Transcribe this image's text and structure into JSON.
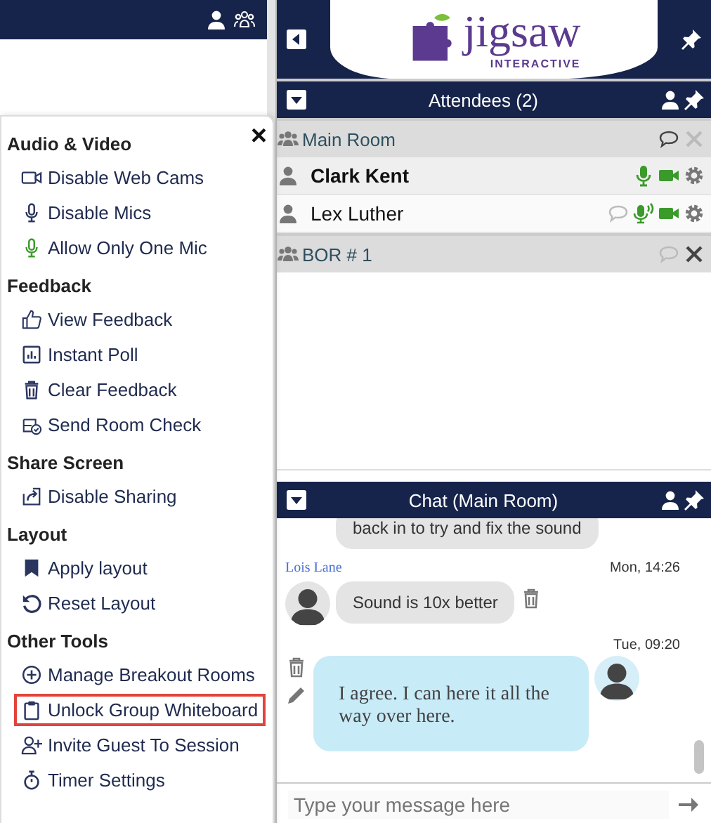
{
  "menu": {
    "close": "×",
    "sections": [
      {
        "title": "Audio & Video",
        "items": [
          {
            "label": "Disable Web Cams",
            "active": false,
            "highlighted": false
          },
          {
            "label": "Disable Mics",
            "active": false,
            "highlighted": false
          },
          {
            "label": "Allow Only One Mic",
            "active": true,
            "highlighted": false
          }
        ]
      },
      {
        "title": "Feedback",
        "items": [
          {
            "label": "View Feedback",
            "active": false,
            "highlighted": false
          },
          {
            "label": "Instant Poll",
            "active": false,
            "highlighted": false
          },
          {
            "label": "Clear Feedback",
            "active": false,
            "highlighted": false
          },
          {
            "label": "Send Room Check",
            "active": false,
            "highlighted": false
          }
        ]
      },
      {
        "title": "Share Screen",
        "items": [
          {
            "label": "Disable Sharing",
            "active": false,
            "highlighted": false
          }
        ]
      },
      {
        "title": "Layout",
        "items": [
          {
            "label": "Apply layout",
            "active": false,
            "highlighted": false
          },
          {
            "label": "Reset Layout",
            "active": false,
            "highlighted": false
          }
        ]
      },
      {
        "title": "Other Tools",
        "items": [
          {
            "label": "Manage Breakout Rooms",
            "active": false,
            "highlighted": false
          },
          {
            "label": "Unlock Group Whiteboard",
            "active": false,
            "highlighted": true
          },
          {
            "label": "Invite Guest To Session",
            "active": false,
            "highlighted": false
          },
          {
            "label": "Timer Settings",
            "active": false,
            "highlighted": false
          }
        ]
      }
    ]
  },
  "logo": {
    "name": "jigsaw",
    "tagline": "INTERACTIVE"
  },
  "attendees": {
    "title": "Attendees (2)",
    "rooms": [
      {
        "name": "Main Room",
        "closable": false,
        "people": [
          {
            "name": "Clark Kent",
            "selected": true,
            "chatting": false,
            "speaking": false
          },
          {
            "name": "Lex Luther",
            "selected": false,
            "chatting": true,
            "speaking": true
          }
        ]
      },
      {
        "name": "BOR # 1",
        "closable": true
      }
    ]
  },
  "chat": {
    "title": "Chat (Main Room)",
    "messages": [
      {
        "own": false,
        "text": "back in to try and fix the sound",
        "avatar": false
      },
      {
        "own": false,
        "sender": "Lois Lane",
        "time": "Mon, 14:26",
        "text": "Sound is 10x better",
        "avatar": true
      },
      {
        "own": true,
        "time": "Tue, 09:20",
        "text": "I agree.  I can here it all the way over here.",
        "avatar": true
      }
    ],
    "placeholder": "Type your message here"
  }
}
